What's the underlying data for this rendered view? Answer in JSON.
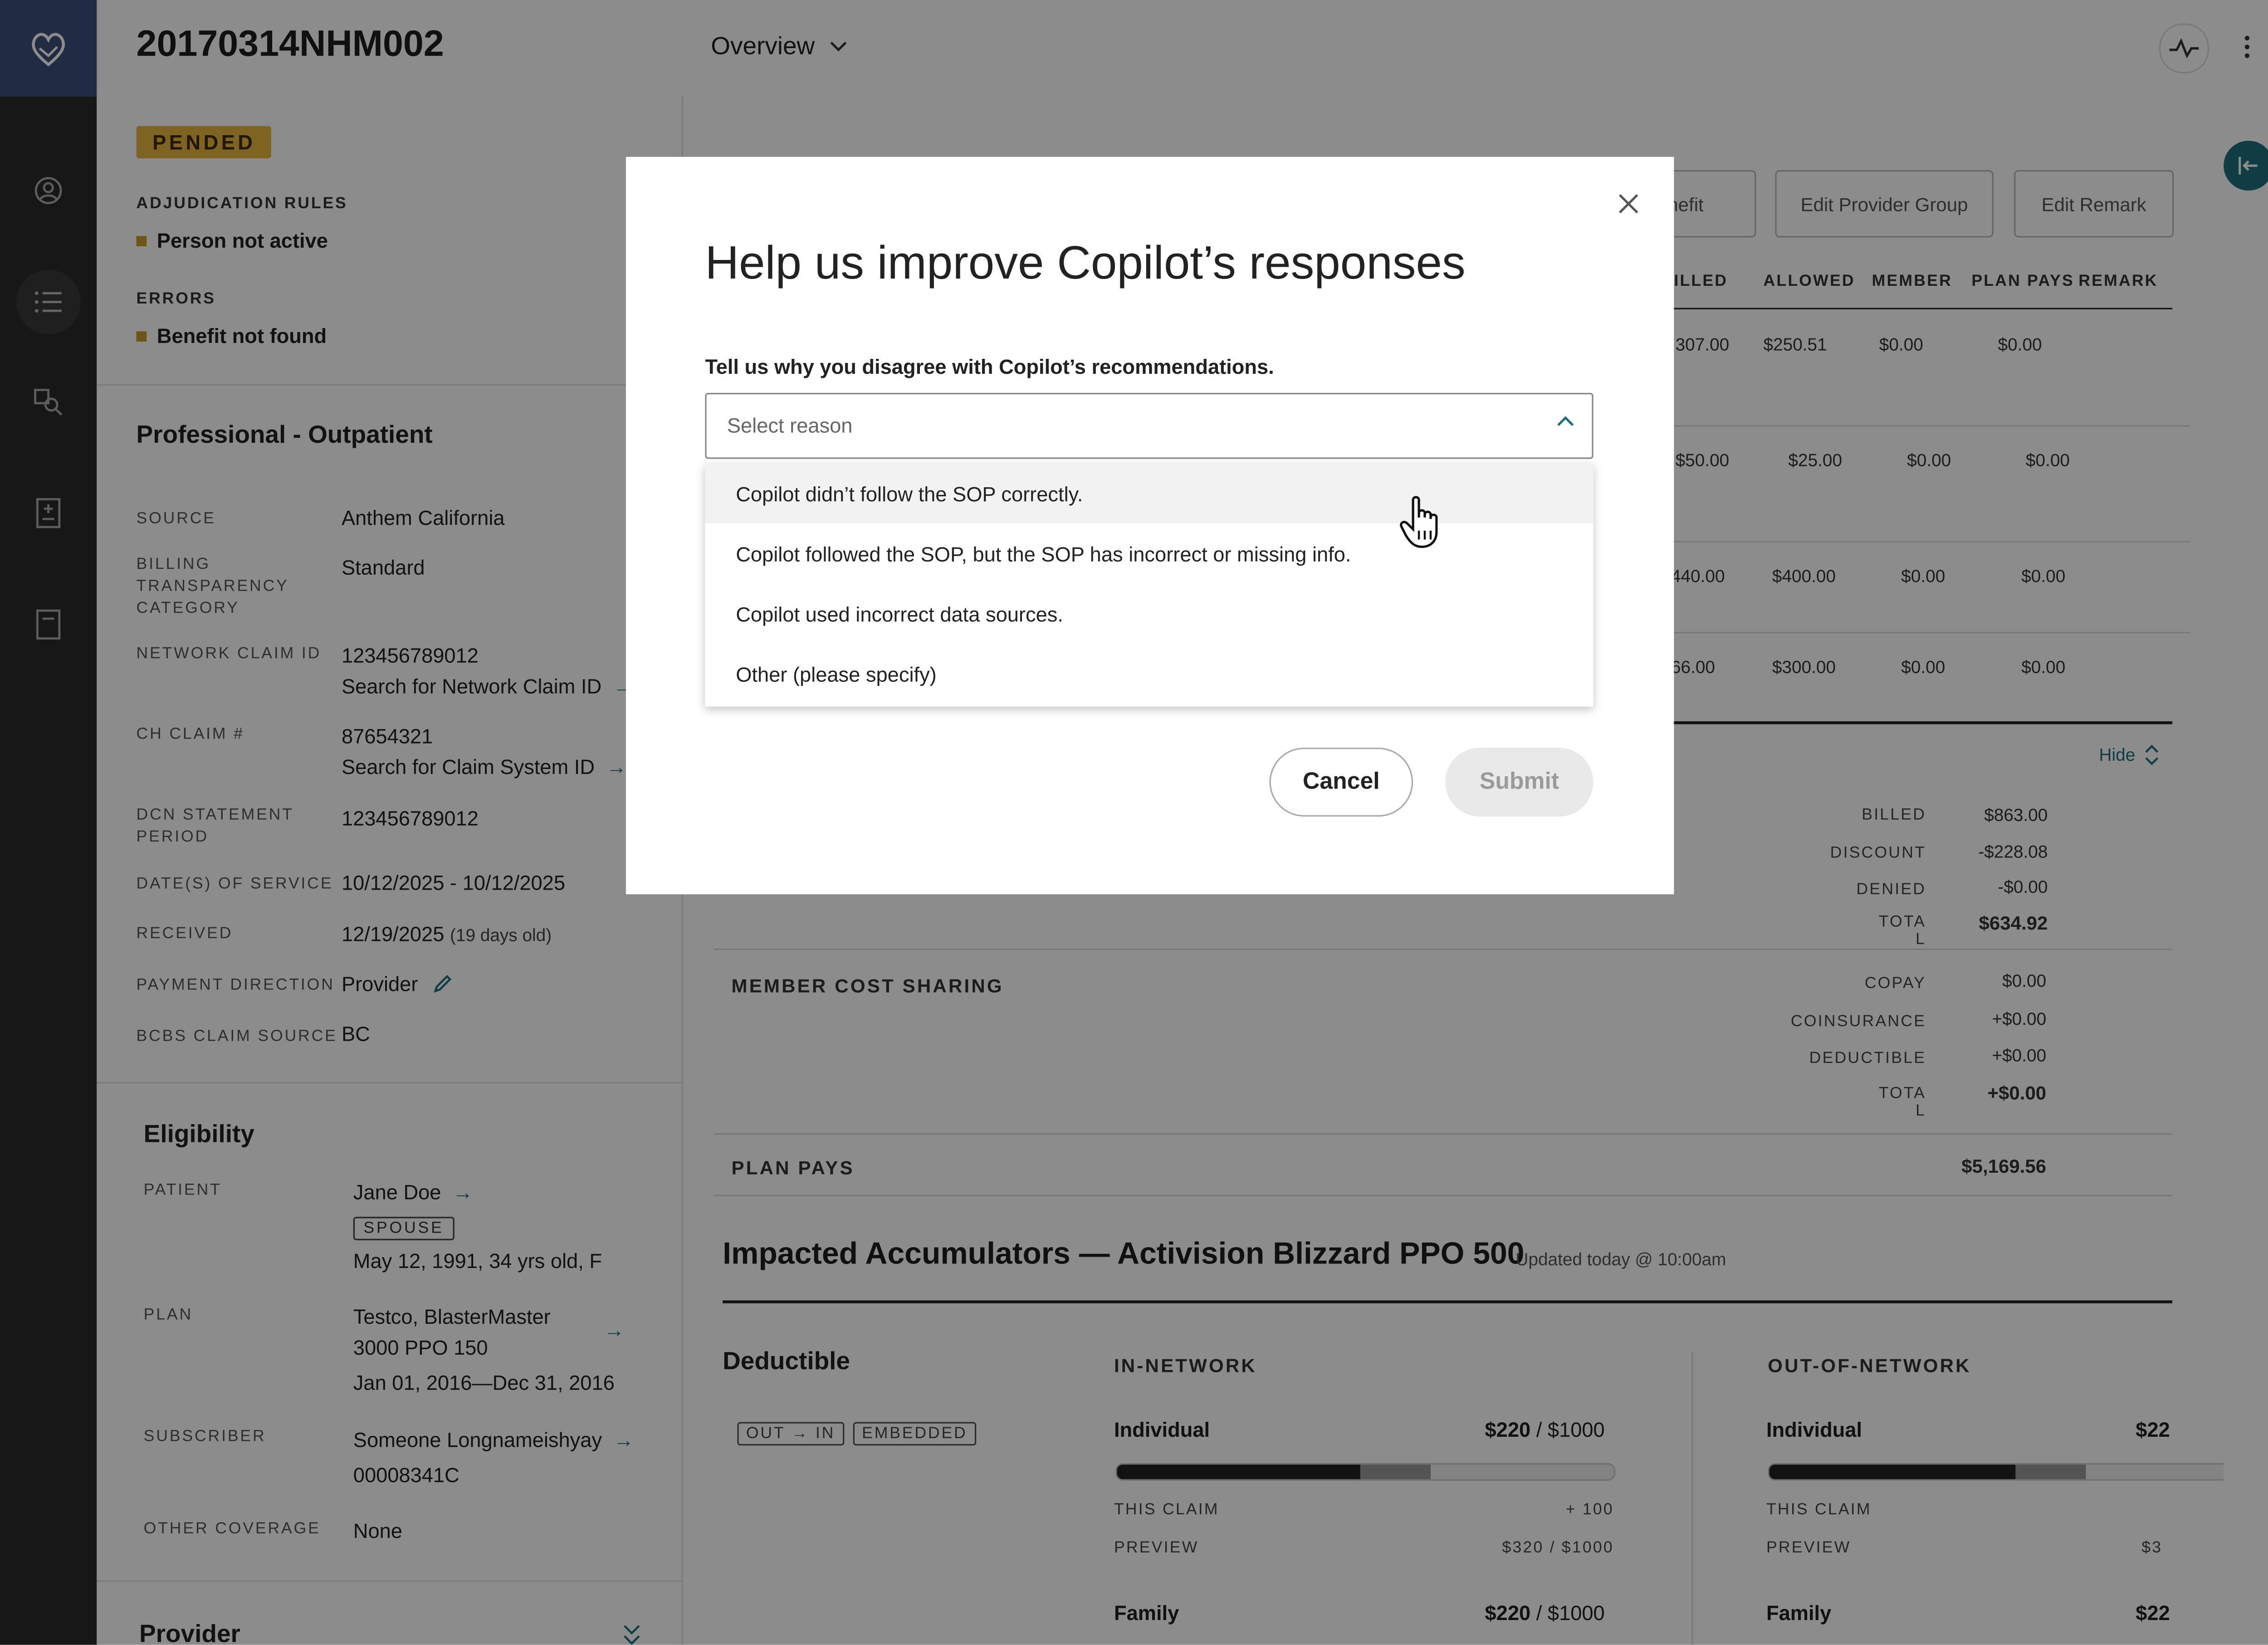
{
  "header": {
    "claim_id": "20170314NHM002",
    "view_label": "Overview"
  },
  "status": {
    "badge": "PENDED",
    "adjudication_label": "ADJUDICATION RULES",
    "adjudication_item": "Person not active",
    "errors_label": "ERRORS",
    "errors_item": "Benefit not found"
  },
  "claim_details": {
    "section_title": "Professional - Outpatient",
    "source_label": "SOURCE",
    "source_value": "Anthem California",
    "billing_label_1": "BILLING",
    "billing_label_2": "TRANSPARENCY",
    "billing_label_3": "CATEGORY",
    "billing_value": "Standard",
    "network_label": "NETWORK CLAIM ID",
    "network_value": "123456789012",
    "network_link": "Search for Network Claim ID",
    "ch_label": "CH CLAIM #",
    "ch_value": "87654321",
    "ch_link": "Search for Claim System ID",
    "dcn_label_1": "DCN STATEMENT",
    "dcn_label_2": "PERIOD",
    "dcn_value": "123456789012",
    "dos_label": "DATE(S) OF SERVICE",
    "dos_value": "10/12/2025 - 10/12/2025",
    "received_label": "RECEIVED",
    "received_value": "12/19/2025",
    "received_age": "(19 days old)",
    "payment_label": "PAYMENT DIRECTION",
    "payment_value": "Provider",
    "bcbs_label": "BCBS CLAIM SOURCE",
    "bcbs_value": "BC"
  },
  "eligibility": {
    "title": "Eligibility",
    "patient_label": "PATIENT",
    "patient_name": "Jane Doe",
    "patient_relation": "SPOUSE",
    "patient_dob": "May 12, 1991, 34 yrs old, F",
    "plan_label": "PLAN",
    "plan_name_1": "Testco, BlasterMaster",
    "plan_name_2": "3000 PPO 150",
    "plan_dates": "Jan 01, 2016—Dec 31, 2016",
    "subscriber_label": "SUBSCRIBER",
    "subscriber_name": "Someone Longnameishyay",
    "subscriber_id": "00008341C",
    "other_label": "OTHER COVERAGE",
    "other_value": "None"
  },
  "provider_title": "Provider",
  "actions": {
    "benefit": "Benefit",
    "edit_provider_group": "Edit Provider Group",
    "edit_remark": "Edit Remark"
  },
  "lines_table": {
    "headers": [
      "ILLED",
      "ALLOWED",
      "MEMBER",
      "PLAN PAYS",
      "REMARK"
    ],
    "rows": [
      [
        "307.00",
        "$250.51",
        "$0.00",
        "$0.00"
      ],
      [
        "$50.00",
        "$25.00",
        "$0.00",
        "$0.00"
      ],
      [
        "440.00",
        "$400.00",
        "$0.00",
        "$0.00"
      ],
      [
        "66.00",
        "$300.00",
        "$0.00",
        "$0.00"
      ]
    ]
  },
  "summary": {
    "hide_label": "Hide",
    "billed_label": "BILLED",
    "billed_value": "$863.00",
    "discount_label": "DISCOUNT",
    "discount_value": "-$228.08",
    "denied_label": "DENIED",
    "denied_value": "-$0.00",
    "total_label_1": "TOTA",
    "total_label_2": "L",
    "total_value": "$634.92",
    "member_cost_label": "MEMBER COST SHARING",
    "copay_label": "COPAY",
    "copay_value": "$0.00",
    "coins_label": "COINSURANCE",
    "coins_value": "+$0.00",
    "deduct_label": "DEDUCTIBLE",
    "deduct_value": "+$0.00",
    "mtotal_label_1": "TOTA",
    "mtotal_label_2": "L",
    "mtotal_value": "+$0.00",
    "plan_pays_label": "PLAN PAYS",
    "plan_pays_value": "$5,169.56"
  },
  "accumulators": {
    "title": "Impacted Accumulators — Activision Blizzard PPO 500",
    "updated": "Updated today @ 10:00am",
    "deductible_title": "Deductible",
    "pill_out": "OUT",
    "pill_in": "IN",
    "pill_embedded": "EMBEDDED",
    "in_network": {
      "heading": "IN-NETWORK",
      "individual_label": "Individual",
      "individual_value": "$220",
      "individual_max": "/ $1000",
      "individual_progress": 0.49,
      "individual_preview_progress": 0.63,
      "this_claim_label": "THIS CLAIM",
      "this_claim_value": "+ 100",
      "preview_label": "PREVIEW",
      "preview_value": "$320 / $1000",
      "family_label": "Family",
      "family_value": "$220",
      "family_max": "/ $1000"
    },
    "out_network": {
      "heading": "OUT-OF-NETWORK",
      "individual_label": "Individual",
      "individual_value": "$22",
      "this_claim_label": "THIS CLAIM",
      "preview_label": "PREVIEW",
      "preview_value": "$3",
      "family_label": "Family",
      "family_value": "$22"
    }
  },
  "modal": {
    "title": "Help us improve Copilot’s responses",
    "question": "Tell us why you disagree with Copilot’s recommendations.",
    "select_placeholder": "Select reason",
    "options": [
      "Copilot didn’t follow the SOP correctly.",
      "Copilot followed the SOP, but the SOP has incorrect or missing info.",
      "Copilot used incorrect data sources.",
      "Other (please specify)"
    ],
    "cancel": "Cancel",
    "submit": "Submit"
  },
  "colors": {
    "accent": "#1e6f7a",
    "rail": "#2b2b2b",
    "pended": "#e8b43e"
  },
  "icons": [
    "logo-icon",
    "user-icon",
    "list-icon",
    "search-doc-icon",
    "document-icon",
    "note-icon",
    "activity-icon",
    "more-icon",
    "chevron-down-icon",
    "close-icon",
    "chevron-up-icon",
    "arrow-right-icon",
    "pencil-icon",
    "collapse-icon",
    "hand-cursor-icon"
  ]
}
